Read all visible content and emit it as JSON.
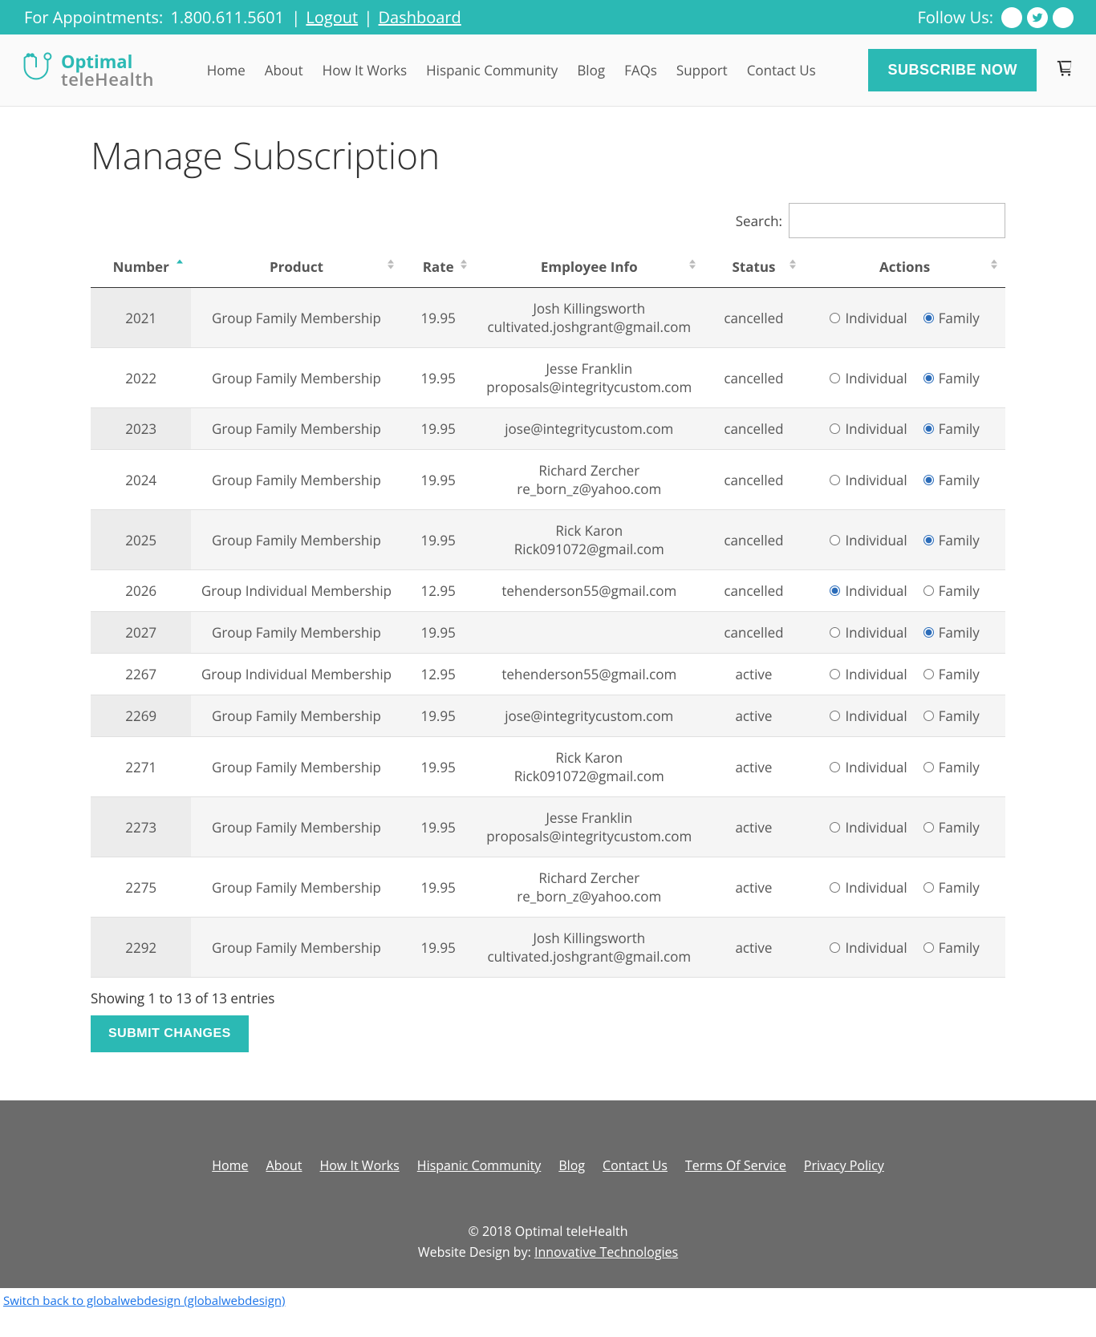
{
  "topbar": {
    "appointments_prefix": "For Appointments: ",
    "phone": "1.800.611.5601",
    "sep": " | ",
    "logout": "Logout",
    "dashboard": "Dashboard",
    "follow": "Follow Us:"
  },
  "logo": {
    "line1": "Optimal",
    "line2": "teleHealth"
  },
  "nav": {
    "home": "Home",
    "about": "About",
    "how": "How It Works",
    "hispanic": "Hispanic Community",
    "blog": "Blog",
    "faqs": "FAQs",
    "support": "Support",
    "contact": "Contact Us"
  },
  "subscribe_label": "SUBSCRIBE NOW",
  "page_title": "Manage Subscription",
  "search_label": "Search:",
  "columns": {
    "number": "Number",
    "product": "Product",
    "rate": "Rate",
    "employee": "Employee Info",
    "status": "Status",
    "actions": "Actions"
  },
  "action_labels": {
    "individual": "Individual",
    "family": "Family"
  },
  "rows": [
    {
      "number": "2021",
      "product": "Group Family Membership",
      "rate": "19.95",
      "emp_name": "Josh Killingsworth",
      "emp_email": "cultivated.joshgrant@gmail.com",
      "status": "cancelled",
      "selected": "family"
    },
    {
      "number": "2022",
      "product": "Group Family Membership",
      "rate": "19.95",
      "emp_name": "Jesse Franklin",
      "emp_email": "proposals@integritycustom.com",
      "status": "cancelled",
      "selected": "family"
    },
    {
      "number": "2023",
      "product": "Group Family Membership",
      "rate": "19.95",
      "emp_name": "",
      "emp_email": "jose@integritycustom.com",
      "status": "cancelled",
      "selected": "family"
    },
    {
      "number": "2024",
      "product": "Group Family Membership",
      "rate": "19.95",
      "emp_name": "Richard Zercher",
      "emp_email": "re_born_z@yahoo.com",
      "status": "cancelled",
      "selected": "family"
    },
    {
      "number": "2025",
      "product": "Group Family Membership",
      "rate": "19.95",
      "emp_name": "Rick Karon",
      "emp_email": "Rick091072@gmail.com",
      "status": "cancelled",
      "selected": "family"
    },
    {
      "number": "2026",
      "product": "Group Individual Membership",
      "rate": "12.95",
      "emp_name": "",
      "emp_email": "tehenderson55@gmail.com",
      "status": "cancelled",
      "selected": "individual"
    },
    {
      "number": "2027",
      "product": "Group Family Membership",
      "rate": "19.95",
      "emp_name": "",
      "emp_email": "",
      "status": "cancelled",
      "selected": "family"
    },
    {
      "number": "2267",
      "product": "Group Individual Membership",
      "rate": "12.95",
      "emp_name": "",
      "emp_email": "tehenderson55@gmail.com",
      "status": "active",
      "selected": "none"
    },
    {
      "number": "2269",
      "product": "Group Family Membership",
      "rate": "19.95",
      "emp_name": "",
      "emp_email": "jose@integritycustom.com",
      "status": "active",
      "selected": "none"
    },
    {
      "number": "2271",
      "product": "Group Family Membership",
      "rate": "19.95",
      "emp_name": "Rick Karon",
      "emp_email": "Rick091072@gmail.com",
      "status": "active",
      "selected": "none"
    },
    {
      "number": "2273",
      "product": "Group Family Membership",
      "rate": "19.95",
      "emp_name": "Jesse Franklin",
      "emp_email": "proposals@integritycustom.com",
      "status": "active",
      "selected": "none"
    },
    {
      "number": "2275",
      "product": "Group Family Membership",
      "rate": "19.95",
      "emp_name": "Richard Zercher",
      "emp_email": "re_born_z@yahoo.com",
      "status": "active",
      "selected": "none"
    },
    {
      "number": "2292",
      "product": "Group Family Membership",
      "rate": "19.95",
      "emp_name": "Josh Killingsworth",
      "emp_email": "cultivated.joshgrant@gmail.com",
      "status": "active",
      "selected": "none"
    }
  ],
  "showing_text": "Showing 1 to 13 of 13 entries",
  "submit_label": "SUBMIT CHANGES",
  "footer_links": {
    "home": "Home",
    "about": "About",
    "how": "How It Works",
    "hispanic": "Hispanic Community",
    "blog": "Blog",
    "contact": "Contact Us",
    "terms": "Terms Of Service",
    "privacy": "Privacy Policy"
  },
  "footer": {
    "copyright": "© 2018 Optimal teleHealth",
    "design_prefix": "Website Design by: ",
    "design_link": "Innovative Technologies"
  },
  "switchback": "Switch back to globalwebdesign (globalwebdesign)"
}
